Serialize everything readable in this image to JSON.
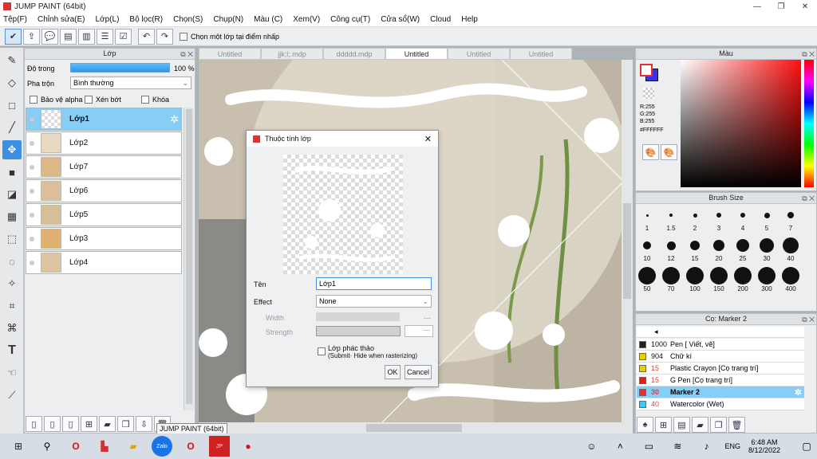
{
  "window": {
    "title": "JUMP PAINT (64bit)"
  },
  "menu": [
    "Tệp(F)",
    "Chỉnh sửa(E)",
    "Lớp(L)",
    "Bộ lọc(R)",
    "Chọn(S)",
    "Chụp(N)",
    "Màu (C)",
    "Xem(V)",
    "Công cụ(T)",
    "Cửa sổ(W)",
    "Cloud",
    "Help"
  ],
  "toolbar": {
    "select_layer_label": "Chọn một lớp tại điểm nhấp"
  },
  "layer_panel": {
    "title": "Lớp",
    "opacity_label": "Độ trong",
    "opacity_value": "100 %",
    "opacity": 1.0,
    "blend_label": "Pha trộn",
    "blend_value": "Bình thường",
    "protect_alpha": "Bảo vệ alpha",
    "clip": "Xén bớt",
    "lock": "Khóa",
    "layers": [
      "Lớp1",
      "Lớp2",
      "Lớp7",
      "Lớp6",
      "Lớp5",
      "Lớp3",
      "Lớp4"
    ]
  },
  "tabs": [
    "Untitled",
    "jjk;l;.mdp",
    "ddddd.mdp",
    "Untitled",
    "Untitled",
    "Untitled"
  ],
  "dialog": {
    "title": "Thuộc tính lớp",
    "name_label": "Tên",
    "name_value": "Lớp1",
    "effect_label": "Effect",
    "effect_value": "None",
    "width_label": "Width",
    "width_value": "---",
    "strength_label": "Strength",
    "strength_value": "---",
    "draft_label": "Lớp phác thảo",
    "draft_note": "(Submit· Hide when rasterizing)",
    "ok": "OK",
    "cancel": "Cancel"
  },
  "color_panel": {
    "title": "Màu",
    "r": "R:255",
    "g": "G:255",
    "b": "B:255",
    "hex": "#FFFFFF"
  },
  "brush_size_panel": {
    "title": "Brush Size",
    "sizes": [
      "1",
      "1.5",
      "2",
      "3",
      "4",
      "5",
      "7",
      "10",
      "12",
      "15",
      "20",
      "25",
      "30",
      "40",
      "50",
      "70",
      "100",
      "150",
      "200",
      "300",
      "400"
    ]
  },
  "brush_panel": {
    "title": "Cọ: Marker 2",
    "brushes": [
      {
        "num": "1000",
        "name": "Pen [ Viết, vẽ]",
        "color": "#222222"
      },
      {
        "num": "904",
        "name": "Chữ kí",
        "color": "#e8d000"
      },
      {
        "num": "15",
        "name": "Plastic Crayon [Cọ trang trí]",
        "color": "#e8d000"
      },
      {
        "num": "15",
        "name": "G Pen [Cọ trang trí]",
        "color": "#e02020"
      },
      {
        "num": "30",
        "name": "Marker 2",
        "color": "#e83030"
      },
      {
        "num": "40",
        "name": "Watercolor (Wet)",
        "color": "#40c8f0"
      }
    ]
  },
  "tooltip": "JUMP PAINT (64bit)",
  "taskbar": {
    "lang": "ENG",
    "time": "6:48 AM",
    "date": "8/12/2022"
  }
}
